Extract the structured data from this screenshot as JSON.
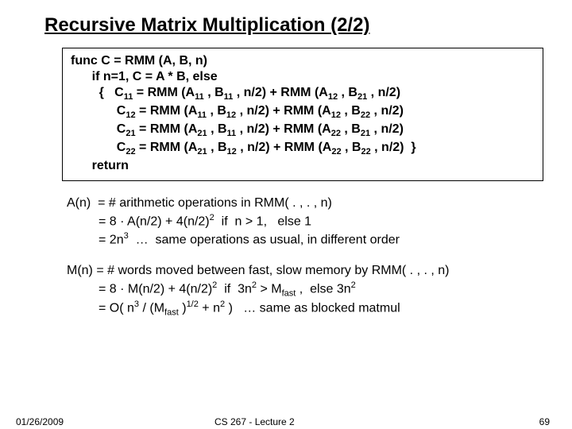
{
  "title": "Recursive Matrix Multiplication (2/2)",
  "code": {
    "l1": "func C = RMM (A, B, n)",
    "l2": "      if n=1, C = A * B, else",
    "l3a": "        {   C",
    "l3b": " = RMM (A",
    "l3c": " , B",
    "l3d": " , n/2) + RMM (A",
    "l3e": " , B",
    "l3f": " , n/2)",
    "sub11a": "11",
    "sub11b": "11",
    "sub11c": "11",
    "sub12": "12",
    "sub21": "21",
    "l4a": "             C",
    "l4b": " = RMM (A",
    "l4c": " , B",
    "l4d": " , n/2) + RMM (A",
    "l4e": " , B",
    "l4f": " , n/2)",
    "s4_1": "12",
    "s4_2": "11",
    "s4_3": "12",
    "s4_4": "12",
    "s4_5": "22",
    "l5a": "             C",
    "l5b": " = RMM (A",
    "l5c": " , B",
    "l5d": " , n/2) + RMM (A",
    "l5e": " , B",
    "l5f": " , n/2)",
    "s5_1": "21",
    "s5_2": "21",
    "s5_3": "11",
    "s5_4": "22",
    "s5_5": "21",
    "l6a": "             C",
    "l6b": " = RMM (A",
    "l6c": " , B",
    "l6d": " , n/2) + RMM (A",
    "l6e": " , B",
    "l6f": " , n/2)  }",
    "s6_1": "22",
    "s6_2": "21",
    "s6_3": "12",
    "s6_4": "22",
    "s6_5": "22",
    "l7": "      return"
  },
  "para1": {
    "l1": "A(n)  = # arithmetic operations in RMM( . , . , n)",
    "l2a": "         = 8 · A(n/2) + 4(n/2)",
    "l2sup": "2",
    "l2b": "  if  n > 1,   else 1",
    "l3a": "         = 2n",
    "l3sup": "3",
    "l3b": "  …  same operations as usual, in different order"
  },
  "para2": {
    "l1": "M(n) = # words moved between fast, slow memory by RMM( . , . , n)",
    "l2a": "         = 8 · M(n/2) + 4(n/2)",
    "l2s1": "2",
    "l2b": "  if  3n",
    "l2s2": "2",
    "l2c": " > M",
    "l2sub": "fast",
    "l2d": " ,  else 3n",
    "l2s3": "2",
    "l3a": "         = O( n",
    "l3s1": "3",
    "l3b": " / (M",
    "l3sub": "fast",
    "l3c": " )",
    "l3s2": "1/2",
    "l3d": " + n",
    "l3s3": "2",
    "l3e": " )   … same as blocked matmul"
  },
  "footer": {
    "date": "01/26/2009",
    "course": "CS 267 - Lecture 2",
    "pagenum": "69"
  }
}
